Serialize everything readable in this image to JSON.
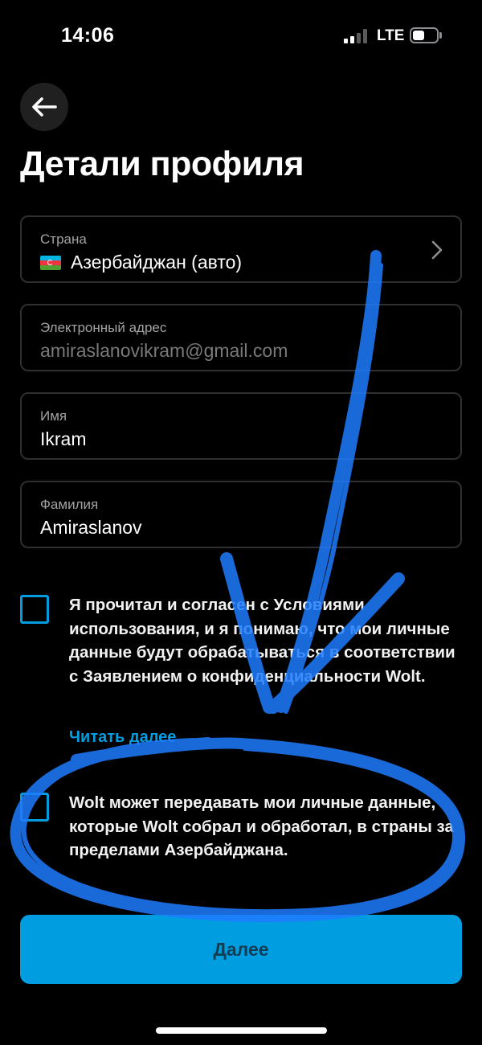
{
  "status_bar": {
    "time": "14:06",
    "network": "LTE",
    "signal_bars_active": 2,
    "battery_level_percent": 50
  },
  "header": {
    "back_icon": "arrow-left-icon",
    "title": "Детали профиля"
  },
  "fields": {
    "country": {
      "label": "Страна",
      "value": "Азербайджан (авто)",
      "flag_icon": "azerbaijan-flag-icon",
      "chevron_icon": "chevron-right-icon"
    },
    "email": {
      "label": "Электронный адрес",
      "value": "amiraslanovikram@gmail.com"
    },
    "first_name": {
      "label": "Имя",
      "value": "Ikram"
    },
    "last_name": {
      "label": "Фамилия",
      "value": "Amiraslanov"
    }
  },
  "consents": {
    "terms": {
      "checked": false,
      "text": "Я прочитал и согласен с Условиями использования, и я понимаю, что мои личные данные будут обрабатываться в соответствии с Заявлением о конфиденциальности Wolt.",
      "read_more": "Читать далее"
    },
    "data_transfer": {
      "checked": false,
      "text": "Wolt может передавать мои личные данные, которые Wolt собрал и обработал, в страны за пределами Азербайджана."
    }
  },
  "continue_button": {
    "label": "Далее"
  },
  "colors": {
    "accent": "#009de0",
    "field_border": "#2f2f2f",
    "label": "#a3a3a3",
    "button_text": "#0f3e55",
    "annotation": "#1e7cff",
    "flag_blue": "#00b5e2",
    "flag_red": "#ef3340",
    "flag_green": "#509e2f"
  }
}
